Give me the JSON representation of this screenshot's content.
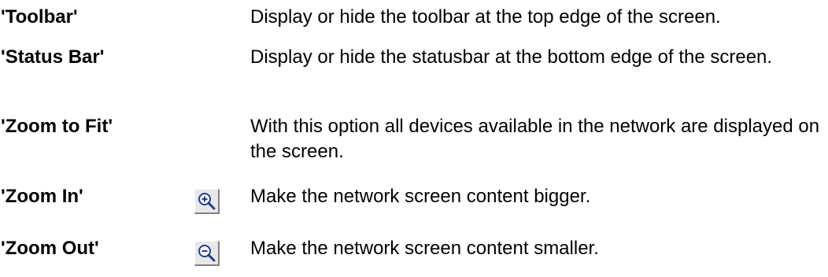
{
  "rows": [
    {
      "term": "'Toolbar'",
      "description": "Display or hide the toolbar at the top edge of the screen."
    },
    {
      "term": "'Status Bar'",
      "description": "Display or hide the statusbar at the bottom edge of the screen."
    },
    {
      "term": "'Zoom to Fit'",
      "description": "With this option all devices available in the network are displayed on the screen."
    },
    {
      "term": "'Zoom In'",
      "description": "Make the network screen content bigger.",
      "icon": "zoom-in-icon"
    },
    {
      "term": "'Zoom Out'",
      "description": "Make the network screen content smaller.",
      "icon": "zoom-out-icon"
    }
  ],
  "colors": {
    "text": "#000000",
    "background": "#ffffff",
    "icon_magnifier": "#1f3f8f",
    "icon_button_face": "#e8e8e8"
  }
}
